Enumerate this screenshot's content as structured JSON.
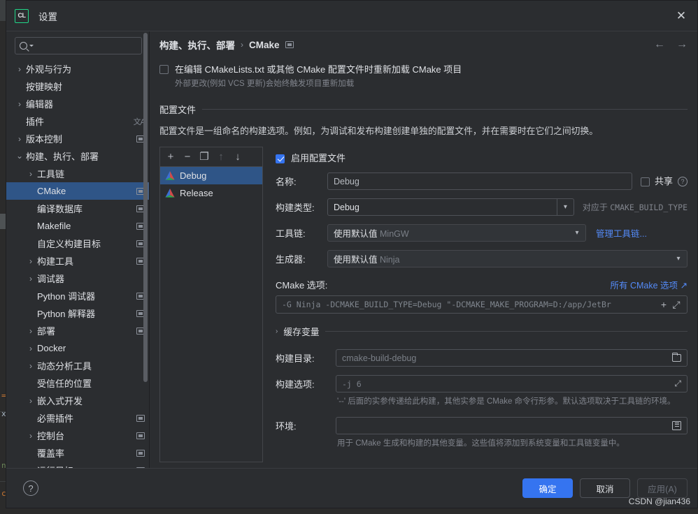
{
  "window": {
    "app_icon": "clion-logo-icon",
    "title": "设置",
    "close_label": "✕"
  },
  "sidebar": {
    "search": {
      "value": "",
      "placeholder": ""
    },
    "items": [
      {
        "label": "外观与行为",
        "chevron": "collapsed",
        "indent": 0,
        "badge": "none"
      },
      {
        "label": "按键映射",
        "chevron": "none",
        "indent": 0,
        "badge": "none"
      },
      {
        "label": "编辑器",
        "chevron": "collapsed",
        "indent": 0,
        "badge": "none"
      },
      {
        "label": "插件",
        "chevron": "none",
        "indent": 0,
        "badge": "translate"
      },
      {
        "label": "版本控制",
        "chevron": "collapsed",
        "indent": 0,
        "badge": "box"
      },
      {
        "label": "构建、执行、部署",
        "chevron": "expanded",
        "indent": 0,
        "badge": "none"
      },
      {
        "label": "工具链",
        "chevron": "collapsed",
        "indent": 1,
        "badge": "none"
      },
      {
        "label": "CMake",
        "chevron": "none",
        "indent": 1,
        "badge": "box",
        "selected": true
      },
      {
        "label": "编译数据库",
        "chevron": "none",
        "indent": 1,
        "badge": "box"
      },
      {
        "label": "Makefile",
        "chevron": "none",
        "indent": 1,
        "badge": "box"
      },
      {
        "label": "自定义构建目标",
        "chevron": "none",
        "indent": 1,
        "badge": "box"
      },
      {
        "label": "构建工具",
        "chevron": "collapsed",
        "indent": 1,
        "badge": "box"
      },
      {
        "label": "调试器",
        "chevron": "collapsed",
        "indent": 1,
        "badge": "none"
      },
      {
        "label": "Python 调试器",
        "chevron": "none",
        "indent": 1,
        "badge": "box"
      },
      {
        "label": "Python 解释器",
        "chevron": "none",
        "indent": 1,
        "badge": "box"
      },
      {
        "label": "部署",
        "chevron": "collapsed",
        "indent": 1,
        "badge": "box"
      },
      {
        "label": "Docker",
        "chevron": "collapsed",
        "indent": 1,
        "badge": "none"
      },
      {
        "label": "动态分析工具",
        "chevron": "collapsed",
        "indent": 1,
        "badge": "none"
      },
      {
        "label": "受信任的位置",
        "chevron": "none",
        "indent": 1,
        "badge": "none"
      },
      {
        "label": "嵌入式开发",
        "chevron": "collapsed",
        "indent": 1,
        "badge": "none"
      },
      {
        "label": "必需插件",
        "chevron": "none",
        "indent": 1,
        "badge": "box"
      },
      {
        "label": "控制台",
        "chevron": "collapsed",
        "indent": 1,
        "badge": "box"
      },
      {
        "label": "覆盖率",
        "chevron": "none",
        "indent": 1,
        "badge": "box"
      },
      {
        "label": "运行目标",
        "chevron": "none",
        "indent": 1,
        "badge": "box"
      }
    ]
  },
  "breadcrumb": {
    "parent": "构建、执行、部署",
    "separator": "›",
    "current": "CMake",
    "badge": "project-scope-icon",
    "nav_back": "←",
    "nav_forward": "→"
  },
  "main": {
    "reload_checkbox": {
      "checked": false,
      "label": "在编辑 CMakeLists.txt 或其他 CMake 配置文件时重新加载 CMake 项目",
      "hint": "外部更改(例如 VCS 更新)会始终触发项目重新加载"
    },
    "profiles_section": {
      "title": "配置文件",
      "description": "配置文件是一组命名的构建选项。例如，为调试和发布构建创建单独的配置文件，并在需要时在它们之间切换。",
      "toolbar": [
        {
          "name": "add-profile-button",
          "glyph": "+",
          "disabled": false
        },
        {
          "name": "remove-profile-button",
          "glyph": "−",
          "disabled": false
        },
        {
          "name": "copy-profile-button",
          "glyph": "❐",
          "disabled": false
        },
        {
          "name": "move-up-button",
          "glyph": "↑",
          "disabled": true
        },
        {
          "name": "move-down-button",
          "glyph": "↓",
          "disabled": false
        }
      ],
      "profiles": [
        {
          "name": "Debug",
          "selected": true
        },
        {
          "name": "Release",
          "selected": false
        }
      ]
    },
    "detail": {
      "enable_profile": {
        "checked": true,
        "label": "启用配置文件"
      },
      "name_row": {
        "label": "名称:",
        "value": "Debug",
        "share_label": "共享",
        "share_checked": false,
        "help_glyph": "?"
      },
      "build_type_row": {
        "label": "构建类型:",
        "value": "Debug",
        "note_prefix": "对应于 ",
        "note_mono": "CMAKE_BUILD_TYPE"
      },
      "toolchain_row": {
        "label": "工具链:",
        "value": "使用默认值",
        "value_muted": "MinGW",
        "link": "管理工具链..."
      },
      "generator_row": {
        "label": "生成器:",
        "value": "使用默认值",
        "value_muted": "Ninja"
      },
      "cmake_options": {
        "label": "CMake 选项:",
        "link": "所有 CMake 选项 ↗",
        "value": "-G Ninja -DCMAKE_BUILD_TYPE=Debug \"-DCMAKE_MAKE_PROGRAM=D:/app/JetBr",
        "add_glyph": "+",
        "expand_glyph": "⤢"
      },
      "cache_vars": {
        "label": "缓存变量",
        "expanded": false,
        "arrow": "›"
      },
      "build_dir_row": {
        "label": "构建目录:",
        "value": "cmake-build-debug",
        "browse_icon": "folder-icon"
      },
      "build_options_row": {
        "label": "构建选项:",
        "value": "-j 6",
        "expand_icon": "expand-icon",
        "hint": "'--' 后面的实参传递给此构建，其他实参是 CMake 命令行形参。默认选项取决于工具链的环境。"
      },
      "environment_row": {
        "label": "环境:",
        "value": "",
        "list_icon": "list-editor-icon",
        "hint": "用于 CMake 生成和构建的其他变量。这些值将添加到系统变量和工具链变量中。"
      }
    }
  },
  "footer": {
    "help_glyph": "?",
    "ok_label": "确定",
    "cancel_label": "取消",
    "apply_label": "应用(A)",
    "apply_disabled": true
  },
  "watermark": "CSDN @jian436",
  "colors": {
    "accent": "#3574f0",
    "selection": "#2f5587",
    "link": "#548af7",
    "panel_bg": "#2b2d30",
    "border": "#4e5157",
    "text": "#dfe1e5",
    "muted": "#80848c",
    "logo_green": "#21d789"
  }
}
